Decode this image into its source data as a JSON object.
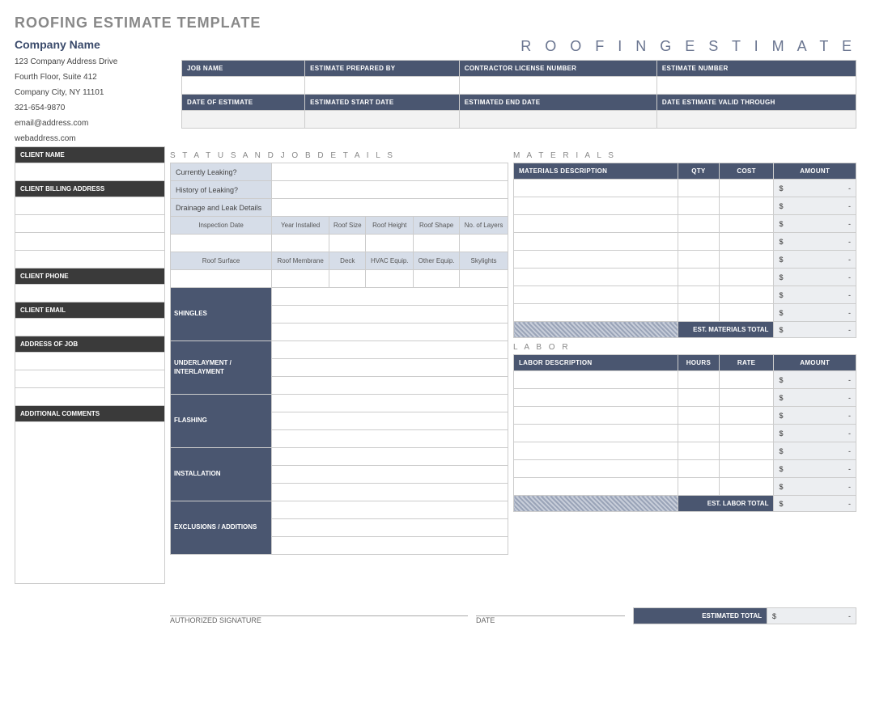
{
  "page_title": "ROOFING ESTIMATE TEMPLATE",
  "company": {
    "name": "Company Name",
    "address1": "123 Company Address Drive",
    "address2": "Fourth Floor, Suite 412",
    "city": "Company City, NY  11101",
    "phone": "321-654-9870",
    "email": "email@address.com",
    "web": "webaddress.com"
  },
  "heading": "R O O F I N G   E S T I M A T E",
  "job_headers": {
    "r1": {
      "a": "JOB NAME",
      "b": "ESTIMATE PREPARED BY",
      "c": "CONTRACTOR LICENSE NUMBER",
      "d": "ESTIMATE NUMBER"
    },
    "r2": {
      "a": "DATE OF ESTIMATE",
      "b": "ESTIMATED START DATE",
      "c": "ESTIMATED END DATE",
      "d": "DATE ESTIMATE VALID THROUGH"
    }
  },
  "sections": {
    "status": "S T A T U S   A N D   J O B   D E T A I L S",
    "materials": "M A T E R I A L S",
    "labor": "L A B O R"
  },
  "client": {
    "name_h": "CLIENT NAME",
    "billing_h": "CLIENT BILLING ADDRESS",
    "phone_h": "CLIENT PHONE",
    "email_h": "CLIENT EMAIL",
    "addr_h": "ADDRESS OF JOB",
    "comments_h": "ADDITIONAL COMMENTS"
  },
  "status": {
    "leaking": "Currently Leaking?",
    "history": "History of Leaking?",
    "drainage": "Drainage and Leak Details",
    "inspect": "Inspection Date",
    "year": "Year Installed",
    "size": "Roof Size",
    "height": "Roof Height",
    "shape": "Roof Shape",
    "layers": "No. of Layers",
    "surface": "Roof Surface",
    "membrane": "Roof Membrane",
    "deck": "Deck",
    "hvac": "HVAC Equip.",
    "other": "Other Equip.",
    "skylights": "Skylights"
  },
  "vert": {
    "shingles": "SHINGLES",
    "underlay": "UNDERLAYMENT / INTERLAYMENT",
    "flashing": "FLASHING",
    "install": "INSTALLATION",
    "excl": "EXCLUSIONS / ADDITIONS"
  },
  "materials": {
    "desc": "MATERIALS DESCRIPTION",
    "qty": "QTY",
    "cost": "COST",
    "amount": "AMOUNT",
    "total": "EST. MATERIALS  TOTAL"
  },
  "labor": {
    "desc": "LABOR DESCRIPTION",
    "hours": "HOURS",
    "rate": "RATE",
    "amount": "AMOUNT",
    "total": "EST. LABOR TOTAL"
  },
  "totals": {
    "est_total": "ESTIMATED TOTAL"
  },
  "money": {
    "prefix": "$",
    "dash": "-"
  },
  "sig": {
    "auth": "AUTHORIZED SIGNATURE",
    "date": "DATE"
  }
}
